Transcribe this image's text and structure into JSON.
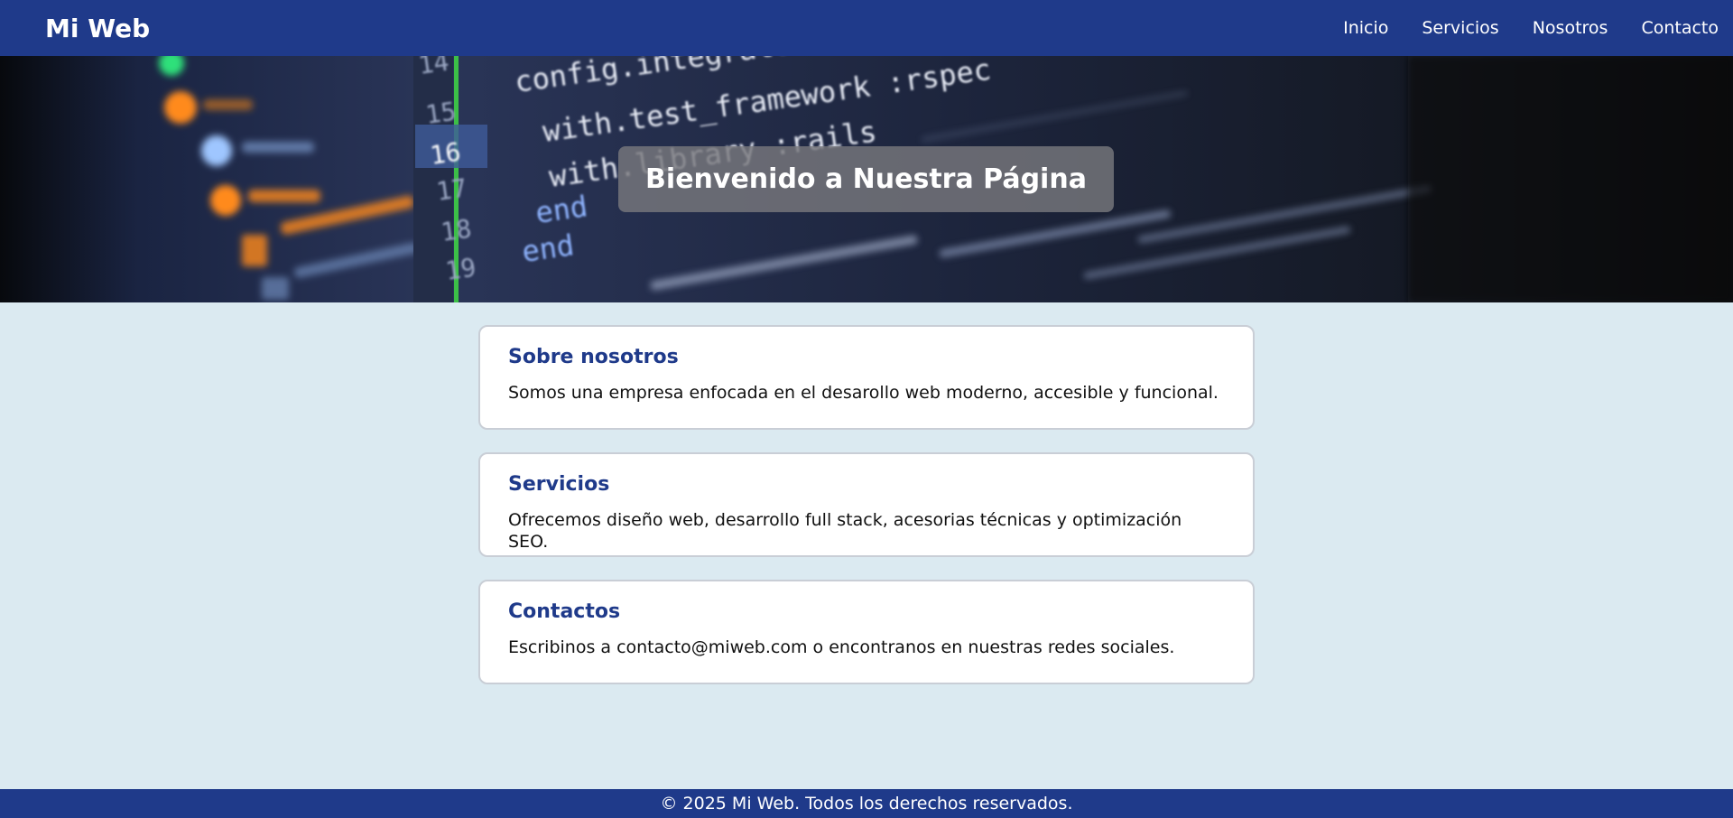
{
  "header": {
    "brand": "Mi Web",
    "nav": [
      "Inicio",
      "Servicios",
      "Nosotros",
      "Contacto"
    ]
  },
  "hero": {
    "title": "Bienvenido a Nuestra Página",
    "code_lines": [
      {
        "num": "14",
        "code": "config.integrate do |setup|"
      },
      {
        "num": "15",
        "code": "with.test_framework :rspec"
      },
      {
        "num": "16",
        "code": "with.library :rails"
      },
      {
        "num": "17",
        "code": "end"
      },
      {
        "num": "18",
        "code": "end"
      },
      {
        "num": "19",
        "code": ""
      }
    ]
  },
  "sections": [
    {
      "title": "Sobre nosotros",
      "text": "Somos una empresa enfocada en el desarollo web moderno, accesible y funcional."
    },
    {
      "title": "Servicios",
      "text": "Ofrecemos diseño web, desarrollo full stack, acesorias técnicas y optimización SEO."
    },
    {
      "title": "Contactos",
      "text": "Escribinos a contacto@miweb.com o encontranos en nuestras redes sociales."
    }
  ],
  "footer": {
    "text": "© 2025 Mi Web. Todos los derechos reservados."
  },
  "colors": {
    "primary": "#1f3a8a",
    "page_background": "#dbeaf1",
    "card_background": "#ffffff",
    "heading": "#1f3a8a"
  }
}
